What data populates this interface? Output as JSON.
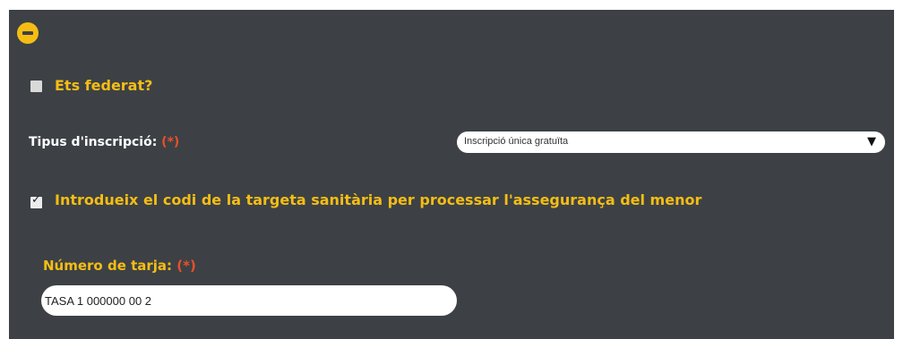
{
  "collapse_icon": "minus-circle-icon",
  "colors": {
    "panel_bg": "#3d4145",
    "accent_yellow": "#f5bd14",
    "required_red": "#e8502a"
  },
  "federat": {
    "checked": false,
    "label": "Ets federat?"
  },
  "inscripcio": {
    "label": "Tipus d'inscripció:",
    "required": "(*)",
    "selected": "Inscripció única gratuïta",
    "arrow_icon": "triangle-down-icon"
  },
  "targeta": {
    "checked": true,
    "label": "Introdueix el codi de la targeta sanitària per processar l'assegurança del menor"
  },
  "tarja": {
    "label": "Número de tarja:",
    "required": "(*)",
    "value": "TASA 1 000000 00 2"
  }
}
